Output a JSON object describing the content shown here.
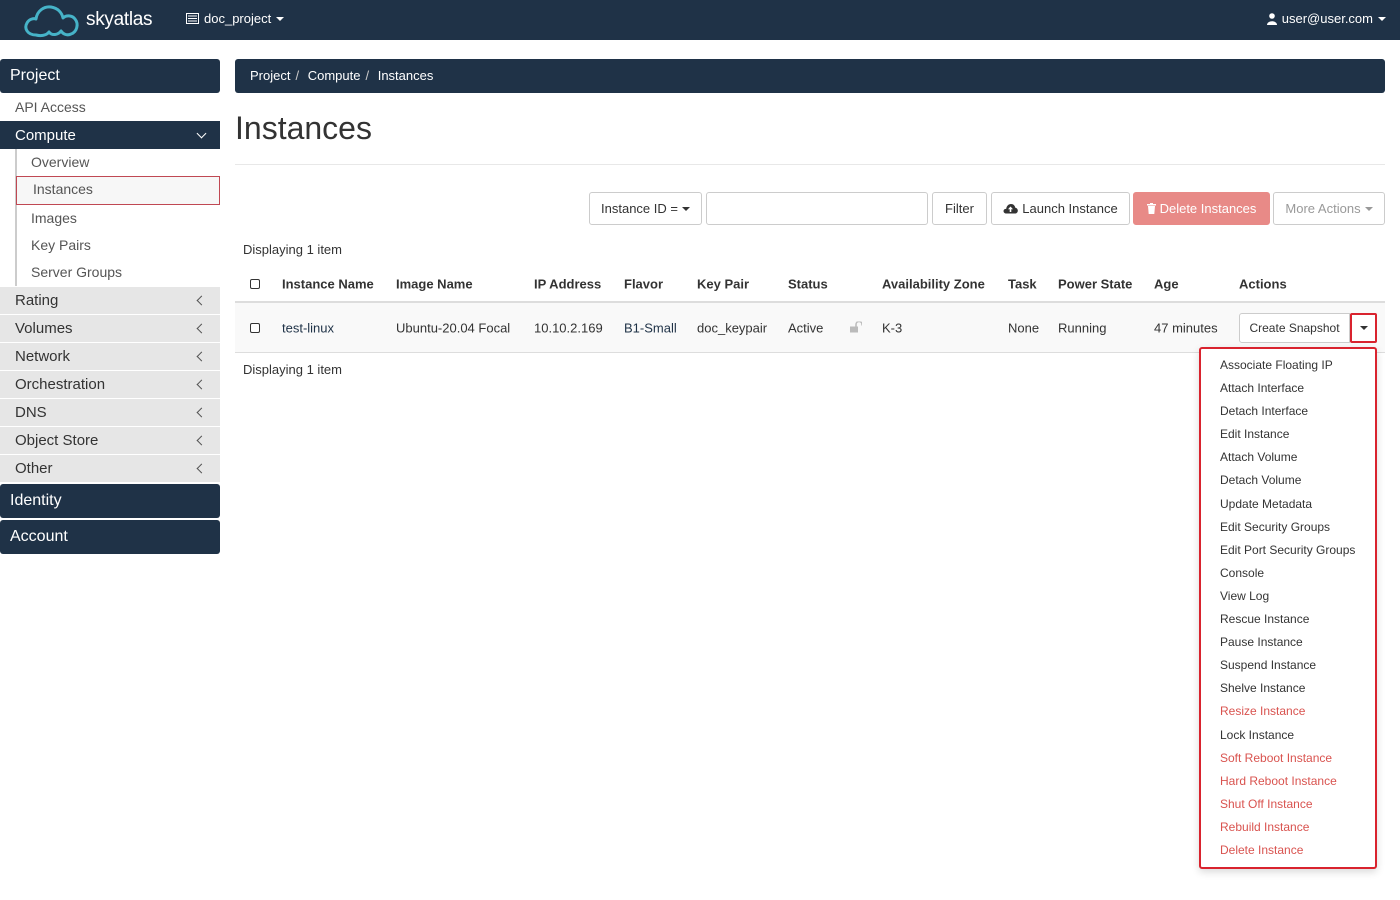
{
  "brand": {
    "name": "skyatlas"
  },
  "topbar": {
    "project": "doc_project",
    "user": "user@user.com"
  },
  "sidebar": {
    "project_label": "Project",
    "api_access": "API Access",
    "compute_label": "Compute",
    "compute_items": [
      "Overview",
      "Instances",
      "Images",
      "Key Pairs",
      "Server Groups"
    ],
    "groups": [
      "Rating",
      "Volumes",
      "Network",
      "Orchestration",
      "DNS",
      "Object Store",
      "Other"
    ],
    "identity_label": "Identity",
    "account_label": "Account"
  },
  "breadcrumb": [
    "Project",
    "Compute",
    "Instances"
  ],
  "page": {
    "title": "Instances"
  },
  "toolbar": {
    "filter_field": "Instance ID =",
    "filter_button": "Filter",
    "launch_button": "Launch Instance",
    "delete_button": "Delete Instances",
    "more_button": "More Actions"
  },
  "table": {
    "count_text": "Displaying 1 item",
    "columns": [
      "Instance Name",
      "Image Name",
      "IP Address",
      "Flavor",
      "Key Pair",
      "Status",
      "Availability Zone",
      "Task",
      "Power State",
      "Age",
      "Actions"
    ],
    "row": {
      "name": "test-linux",
      "image": "Ubuntu-20.04 Focal",
      "ip": "10.10.2.169",
      "flavor": "B1-Small",
      "keypair": "doc_keypair",
      "status": "Active",
      "zone": "K-3",
      "task": "None",
      "power": "Running",
      "age": "47 minutes",
      "action": "Create Snapshot"
    }
  },
  "actions_menu": [
    {
      "label": "Associate Floating IP",
      "danger": false
    },
    {
      "label": "Attach Interface",
      "danger": false
    },
    {
      "label": "Detach Interface",
      "danger": false
    },
    {
      "label": "Edit Instance",
      "danger": false
    },
    {
      "label": "Attach Volume",
      "danger": false
    },
    {
      "label": "Detach Volume",
      "danger": false
    },
    {
      "label": "Update Metadata",
      "danger": false
    },
    {
      "label": "Edit Security Groups",
      "danger": false
    },
    {
      "label": "Edit Port Security Groups",
      "danger": false
    },
    {
      "label": "Console",
      "danger": false
    },
    {
      "label": "View Log",
      "danger": false
    },
    {
      "label": "Rescue Instance",
      "danger": false
    },
    {
      "label": "Pause Instance",
      "danger": false
    },
    {
      "label": "Suspend Instance",
      "danger": false
    },
    {
      "label": "Shelve Instance",
      "danger": false
    },
    {
      "label": "Resize Instance",
      "danger": true
    },
    {
      "label": "Lock Instance",
      "danger": false
    },
    {
      "label": "Soft Reboot Instance",
      "danger": true
    },
    {
      "label": "Hard Reboot Instance",
      "danger": true
    },
    {
      "label": "Shut Off Instance",
      "danger": true
    },
    {
      "label": "Rebuild Instance",
      "danger": true
    },
    {
      "label": "Delete Instance",
      "danger": true
    }
  ],
  "colors": {
    "navy": "#1f3247",
    "danger": "#d9534f",
    "highlight": "#d9232e"
  }
}
